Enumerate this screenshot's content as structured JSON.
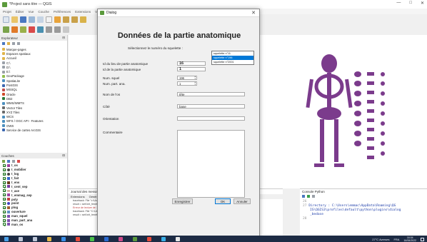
{
  "window": {
    "title": "*Project sans titre — QGIS",
    "controls": [
      "—",
      "□",
      "✕"
    ]
  },
  "menu": [
    "Projet",
    "Éditer",
    "Vue",
    "Couche",
    "Préférences",
    "Extensions",
    "Vecteur",
    "Raster"
  ],
  "panels": {
    "browser_title": "Explorateur",
    "browser_items": [
      {
        "label": "Marque-pages",
        "color": "#e0b44a"
      },
      {
        "label": "Espaces spatiaux",
        "color": "#e0b44a"
      },
      {
        "label": "Accueil",
        "color": "#e0b44a"
      },
      {
        "label": "C:\\",
        "color": "#9aa0a8"
      },
      {
        "label": "D:\\",
        "color": "#9aa0a8"
      },
      {
        "label": "E:\\",
        "color": "#9aa0a8"
      },
      {
        "label": "GeoPackage",
        "color": "#8fbf4c"
      },
      {
        "label": "SpatiaLite",
        "color": "#4c8fbf"
      },
      {
        "label": "PostGIS",
        "color": "#3a66b0"
      },
      {
        "label": "MSSQL",
        "color": "#bf4c4c"
      },
      {
        "label": "Oracle",
        "color": "#d04a2a"
      },
      {
        "label": "DB2",
        "color": "#2a7a3a"
      },
      {
        "label": "WMS/WMTS",
        "color": "#4c8fbf"
      },
      {
        "label": "Vector Tiles",
        "color": "#6a6a6a"
      },
      {
        "label": "XYZ Tiles",
        "color": "#6a6a6a"
      },
      {
        "label": "WCS",
        "color": "#4c8fbf"
      },
      {
        "label": "WFS / OGC API - Features",
        "color": "#4c8fbf"
      },
      {
        "label": "OWS",
        "color": "#4c8fbf"
      },
      {
        "label": "Service de cartes ArcGIS",
        "color": "#3a66b0"
      }
    ],
    "layers_title": "Couches",
    "layers": [
      {
        "label": "t_os",
        "color": "#a040a0",
        "bold": true
      },
      {
        "label": "t_mobilier",
        "color": "#444444",
        "bold": true
      },
      {
        "label": "t_log",
        "color": "#444444",
        "bold": true
      },
      {
        "label": "t_fait",
        "color": "#3366cc",
        "bold": true
      },
      {
        "label": "t_ens",
        "color": "#6a3a1a",
        "bold": true
      },
      {
        "label": "t_cent_sep",
        "color": "#7a3aa0",
        "bold": true
      },
      {
        "label": "t_axe",
        "color": "#9a4020",
        "bold": true
      },
      {
        "label": "t_emmag_sep",
        "color": "#a040a0",
        "bold": true
      },
      {
        "label": "poly",
        "color": "#c04040",
        "bold": true
      },
      {
        "label": "point",
        "color": "#4040c0",
        "bold": true
      },
      {
        "label": "plog",
        "color": "#a06030",
        "bold": true
      },
      {
        "label": "ouverture",
        "color": "#6090c0",
        "bold": true
      },
      {
        "label": "man_squel",
        "color": "#8050b0",
        "bold": true
      },
      {
        "label": "man_part_ana",
        "color": "#8050b0",
        "bold": true
      },
      {
        "label": "man_os",
        "color": "#8050b0",
        "bold": true
      }
    ]
  },
  "log": {
    "title": "Journal des messages",
    "tabs": [
      "Extensions",
      "Général"
    ],
    "lines": [
      "traceback: File \"c:\\Users\\emmac\\AppData\\Roaming\\QGIS\\QGIS3\\profiles\\default\\python\\plugins\\dialog_bedase.py\", line 383, in run",
      "result = self.init_fenetr",
      "Erreur de lecture de : ...",
      "traceback: File \"C:\\Users\\emmac\\AppData\\Roaming\\QGIS\\QGIS3\\profiles\\default\\python\\plugins\\dialog_bedase\\dialog_bedase.py\", line 383, in run",
      "result = self.init_fenetre.exec_()"
    ]
  },
  "console": {
    "title": "Console Python",
    "lines": [
      {
        "n": "26",
        "text": ""
      },
      {
        "n": "27",
        "text": "Directory : C:\\Users\\emmac\\AppData\\Roaming\\QG"
      },
      {
        "n": "",
        "text": "IS\\QGIS3\\profiles\\default\\python\\plugins\\dialog"
      },
      {
        "n": "",
        "text": "_bedase"
      },
      {
        "n": "28",
        "text": ""
      }
    ]
  },
  "dialog": {
    "title": "Dialog",
    "heading": "Données de la partie anatomique",
    "select_label": "Sélectionnez le numéro du squelette :",
    "squelette_options": [
      "squelette n°11",
      "squelette n°196",
      "squelette n°2001"
    ],
    "squelette_selected_index": 1,
    "fields": {
      "id_lieu_label": "Id du lieu de partie anatomique",
      "id_lieu_value": "16",
      "id_partie_label": "Id de la partie anatomique",
      "id_partie_value": "1",
      "num_squel_label": "Num. squel",
      "num_squel_value": "196",
      "num_part_label": "Num. part. ana.",
      "num_part_value": "1",
      "nom_os_label": "Nom de l'os",
      "nom_os_value": "tête",
      "cote_label": "Côté",
      "cote_value": "base",
      "orientation_label": "Orientation",
      "orientation_value": "",
      "commentaire_label": "Commentaire"
    },
    "buttons": {
      "save": "Enregistrer",
      "ok": "OK",
      "cancel": "Annuler"
    }
  },
  "taskbar": {
    "weather": "27°C Averses",
    "lang": "FRA",
    "time": "16:04",
    "date": "16/06/2022"
  },
  "colors": {
    "skeleton": "#7b3b8c",
    "selection": "#0078d7",
    "taskbar": "#1d2b44"
  }
}
